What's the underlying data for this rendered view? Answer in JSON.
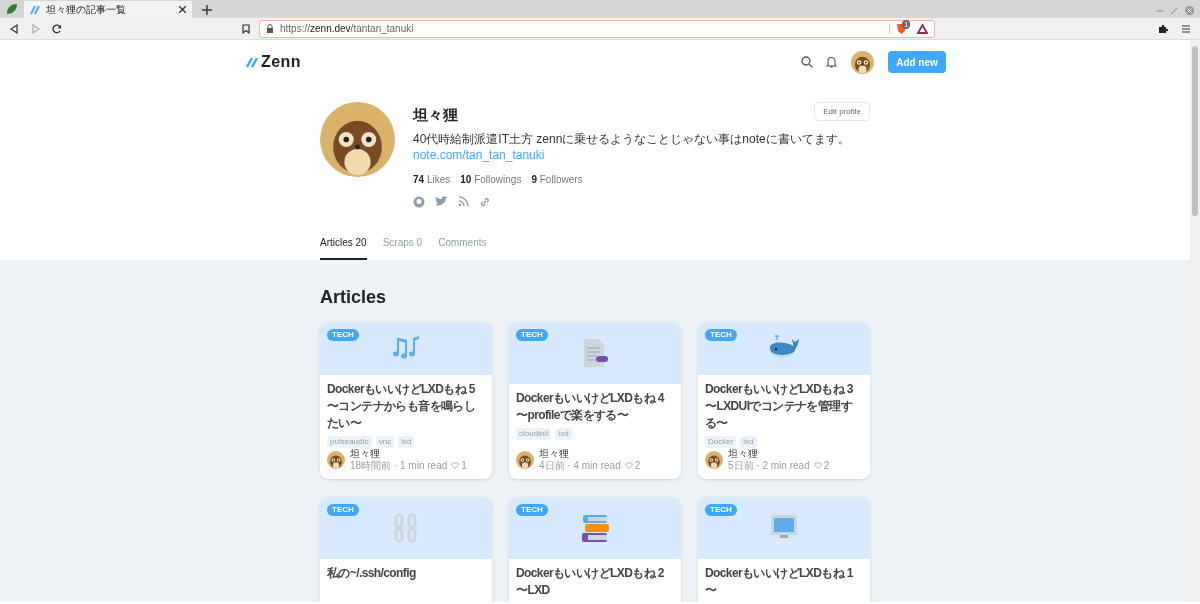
{
  "browser": {
    "tab_title": "坦々狸の記事一覧",
    "url_scheme": "https://",
    "url_host": "zenn.dev",
    "url_path": "/tantan_tanuki",
    "shield_count": "1"
  },
  "header": {
    "logo": "Zenn",
    "add_button": "Add new"
  },
  "profile": {
    "name": "坦々狸",
    "edit_button": "Edit profile",
    "bio": "40代時給制派遣IT土方 zennに乗せるようなことじゃない事はnoteに書いてます。",
    "bio_link": "note.com/tan_tan_tanuki",
    "stats": [
      {
        "count": "74",
        "label": "Likes"
      },
      {
        "count": "10",
        "label": "Followings"
      },
      {
        "count": "9",
        "label": "Followers"
      }
    ]
  },
  "tabs": [
    {
      "label": "Articles 20",
      "selected": true
    },
    {
      "label": "Scraps 0",
      "selected": false
    },
    {
      "label": "Comments",
      "selected": false
    }
  ],
  "section_title": "Articles",
  "articles": [
    {
      "badge": "TECH",
      "title": "DockerもいいけどLXDもね 5 〜コンテナからも音を鳴らしたい〜",
      "tags": [
        "pulseaudio",
        "vnc",
        "lxd"
      ],
      "author": "坦々狸",
      "meta": "18時間前 · 1 min read",
      "likes": "1"
    },
    {
      "badge": "TECH",
      "title": "DockerもいいけどLXDもね 4 〜profileで楽をする〜",
      "tags": [
        "cloudinit",
        "lxd"
      ],
      "author": "坦々狸",
      "meta": "4日前 · 4 min read",
      "likes": "2"
    },
    {
      "badge": "TECH",
      "title": "DockerもいいけどLXDもね 3 〜LXDUIでコンテナを管理する〜",
      "tags": [
        "Docker",
        "lxd"
      ],
      "author": "坦々狸",
      "meta": "5日前 · 2 min read",
      "likes": "2"
    },
    {
      "badge": "TECH",
      "title": "私の~/.ssh/config"
    },
    {
      "badge": "TECH",
      "title": "DockerもいいけどLXDもね 2 〜LXD"
    },
    {
      "badge": "TECH",
      "title": "DockerもいいけどLXDもね 1 〜"
    }
  ]
}
